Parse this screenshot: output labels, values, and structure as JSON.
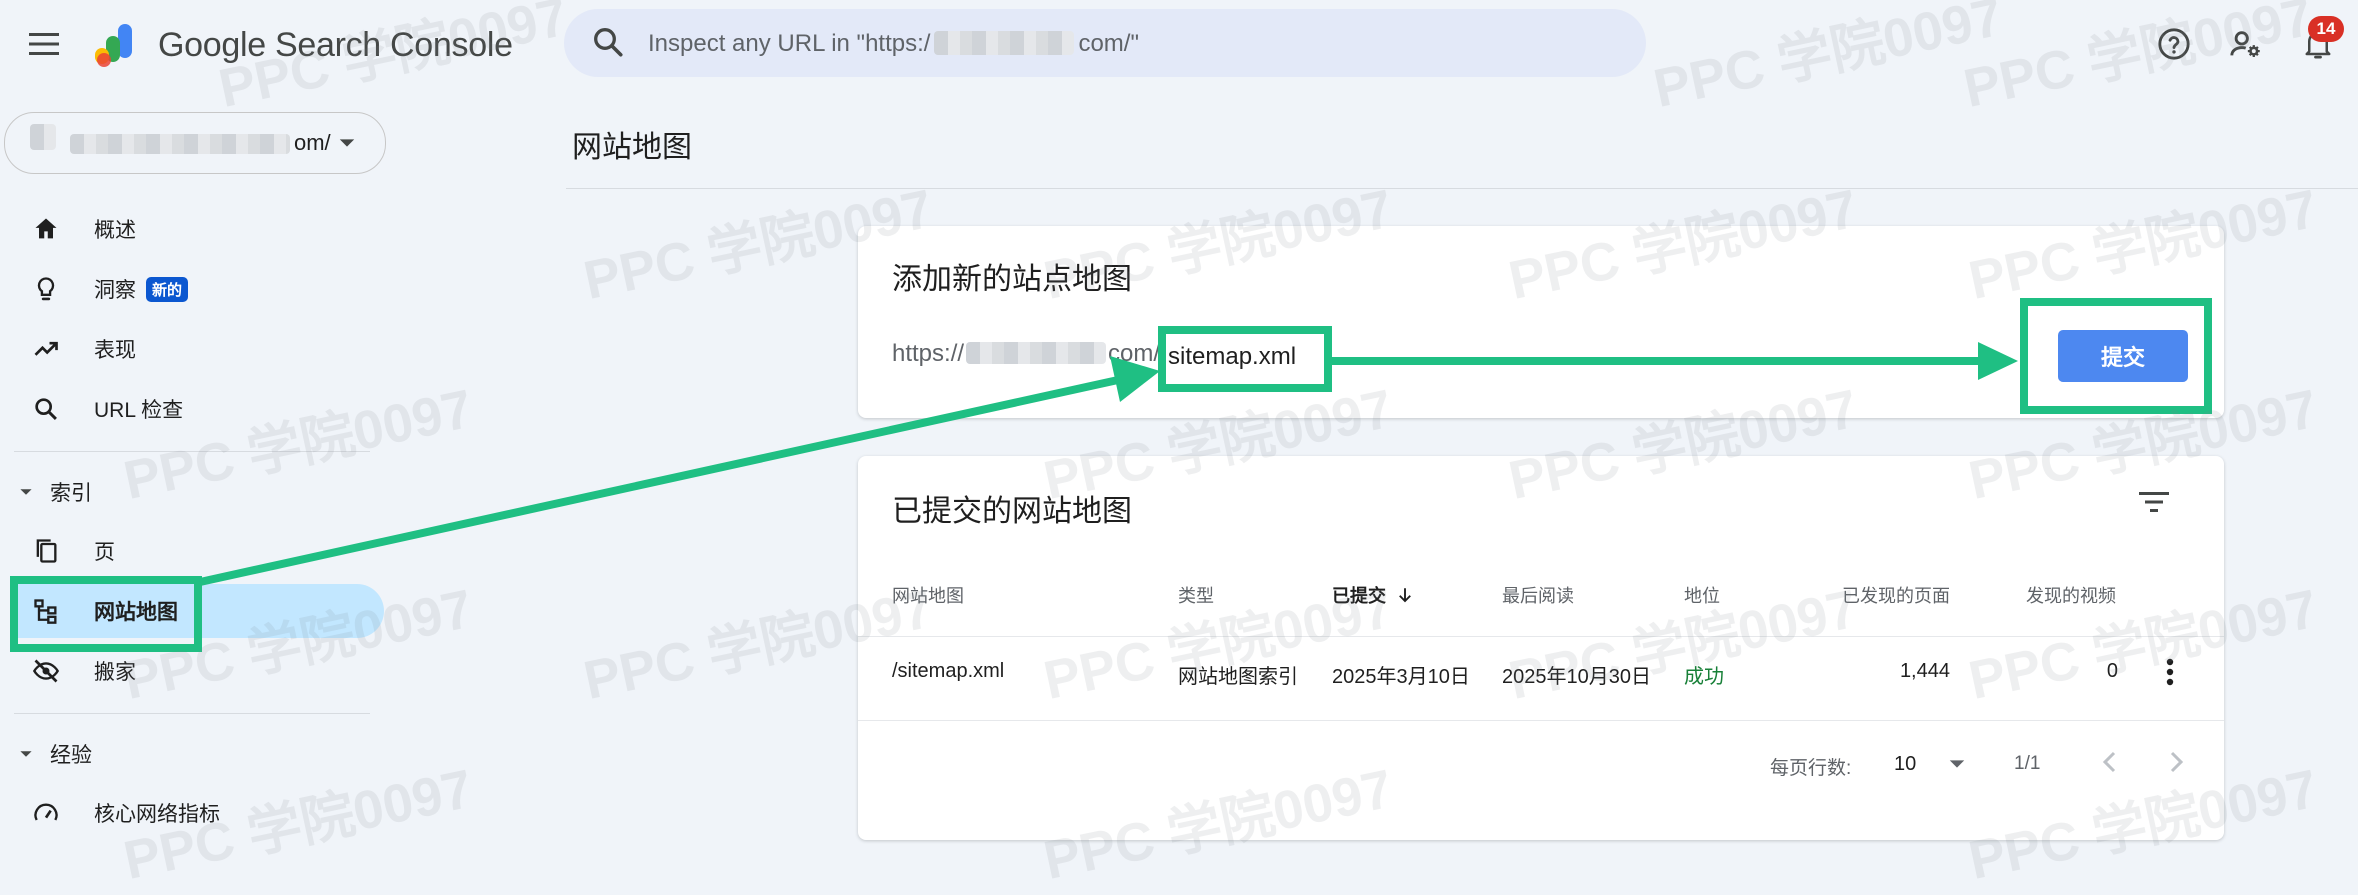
{
  "app": {
    "product_name": "Google Search Console",
    "search_placeholder_start": "Inspect any URL in \"https:/",
    "search_placeholder_end": "com/\"",
    "notification_count": "14"
  },
  "property": {
    "domain_suffix": "om/"
  },
  "sidebar": {
    "items_top": [
      {
        "label": "概述",
        "icon": "home-icon"
      },
      {
        "label": "洞察",
        "icon": "lightbulb-icon",
        "badge": "新的"
      },
      {
        "label": "表现",
        "icon": "trending-up-icon"
      },
      {
        "label": "URL 检查",
        "icon": "search-icon"
      }
    ],
    "section_index": "索引",
    "items_index": [
      {
        "label": "页",
        "icon": "pages-icon"
      },
      {
        "label": "网站地图",
        "icon": "sitemap-icon"
      },
      {
        "label": "搬家",
        "icon": "visibility-off-icon"
      }
    ],
    "section_experience": "经验",
    "items_experience": [
      {
        "label": "核心网络指标",
        "icon": "speed-icon"
      }
    ]
  },
  "main": {
    "page_title": "网站地图",
    "add_card": {
      "title": "添加新的站点地图",
      "url_prefix_start": "https://",
      "url_prefix_end": "com/",
      "input_value": "sitemap.xml",
      "submit_label": "提交"
    },
    "submitted_card": {
      "title": "已提交的网站地图",
      "columns": [
        "网站地图",
        "类型",
        "已提交",
        "最后阅读",
        "地位",
        "已发现的页面",
        "发现的视频"
      ],
      "rows": [
        {
          "sitemap": "/sitemap.xml",
          "type": "网站地图索引",
          "submitted": "2025年3月10日",
          "last_read": "2025年10月30日",
          "status": "成功",
          "pages": "1,444",
          "videos": "0"
        }
      ],
      "pager": {
        "rows_per_page_label": "每页行数:",
        "rows_per_page": "10",
        "range": "1/1"
      }
    }
  },
  "watermark": "PPC 学院0097",
  "colors": {
    "accent_green": "#1fbf83",
    "button_blue": "#4d88f0",
    "active_nav": "#c2e7ff",
    "status_ok": "#188038"
  }
}
